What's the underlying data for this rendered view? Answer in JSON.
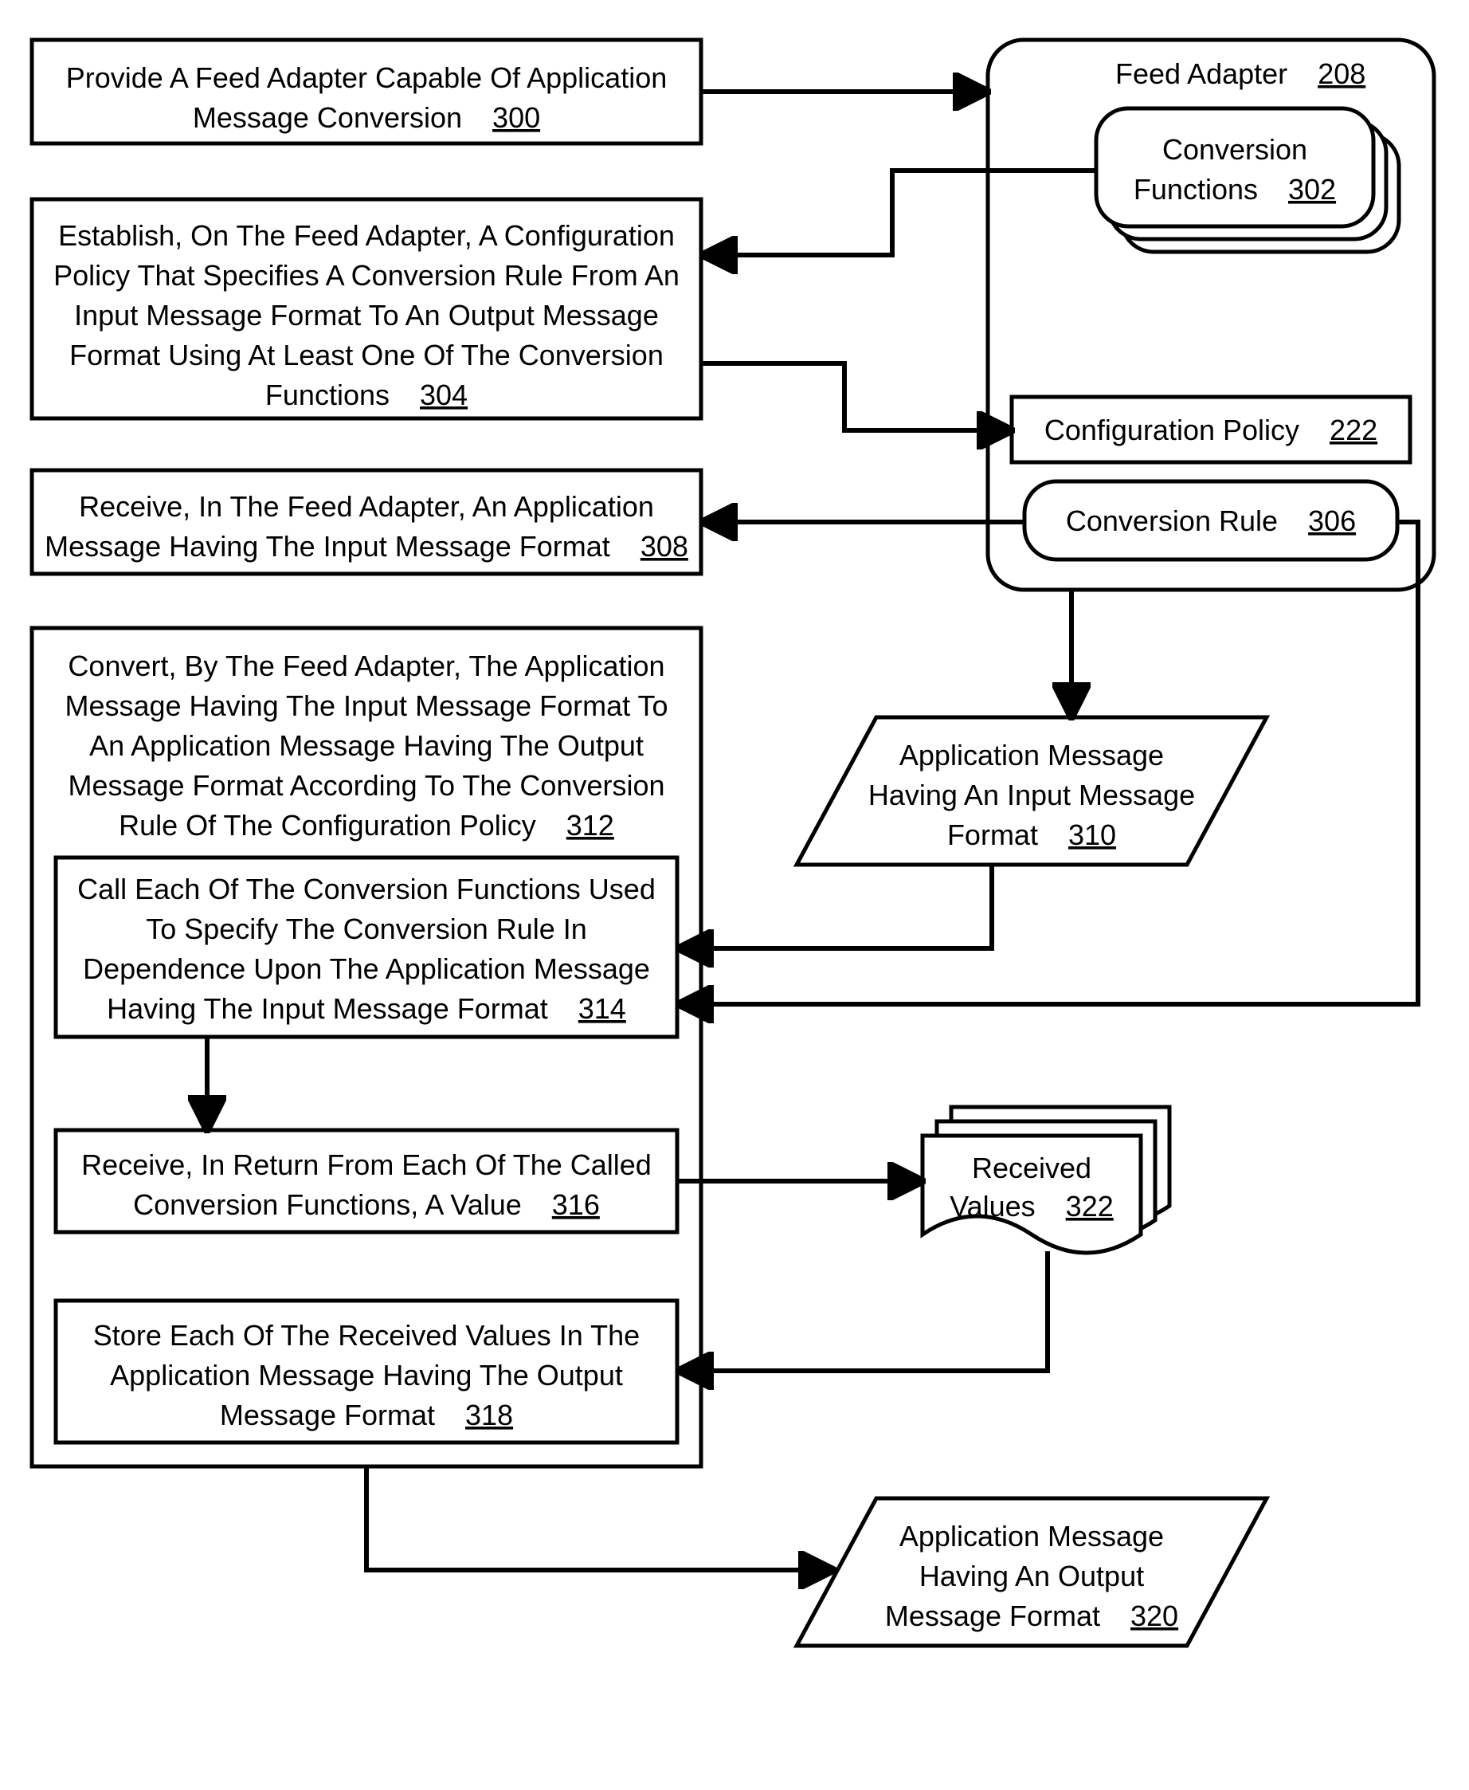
{
  "feedAdapter": {
    "title": "Feed Adapter",
    "num": "208"
  },
  "convFunc": {
    "line1": "Conversion",
    "line2": "Functions",
    "num": "302"
  },
  "confPolicy": {
    "label": "Configuration Policy",
    "num": "222"
  },
  "convRule": {
    "label": "Conversion Rule",
    "num": "306"
  },
  "step300": {
    "line1": "Provide A Feed Adapter Capable Of Application",
    "line2": "Message Conversion",
    "num": "300"
  },
  "step304": {
    "line1": "Establish, On The Feed Adapter, A Configuration",
    "line2": "Policy That Specifies A Conversion Rule From An",
    "line3": "Input Message Format To An Output Message",
    "line4": "Format Using At Least One Of The Conversion",
    "line5": "Functions",
    "num": "304"
  },
  "step308": {
    "line1": "Receive, In The Feed Adapter, An Application",
    "line2": "Message Having The Input Message Format",
    "num": "308"
  },
  "step312": {
    "line1": "Convert, By The Feed Adapter, The Application",
    "line2": "Message Having The Input Message Format To",
    "line3": "An Application Message Having The Output",
    "line4": "Message Format According To The Conversion",
    "line5": "Rule Of The Configuration Policy",
    "num": "312"
  },
  "step314": {
    "line1": "Call Each Of The Conversion Functions Used",
    "line2": "To Specify The Conversion Rule In",
    "line3": "Dependence Upon The Application Message",
    "line4": "Having The Input Message Format",
    "num": "314"
  },
  "step316": {
    "line1": "Receive, In Return From Each Of The Called",
    "line2": "Conversion Functions, A Value",
    "num": "316"
  },
  "step318": {
    "line1": "Store Each Of The Received Values In The",
    "line2": "Application Message Having The Output",
    "line3": "Message Format",
    "num": "318"
  },
  "msgIn": {
    "line1": "Application Message",
    "line2": "Having An Input Message",
    "line3": "Format",
    "num": "310"
  },
  "recVals": {
    "line1": "Received",
    "line2": "Values",
    "num": "322"
  },
  "msgOut": {
    "line1": "Application Message",
    "line2": "Having An Output",
    "line3": "Message Format",
    "num": "320"
  }
}
